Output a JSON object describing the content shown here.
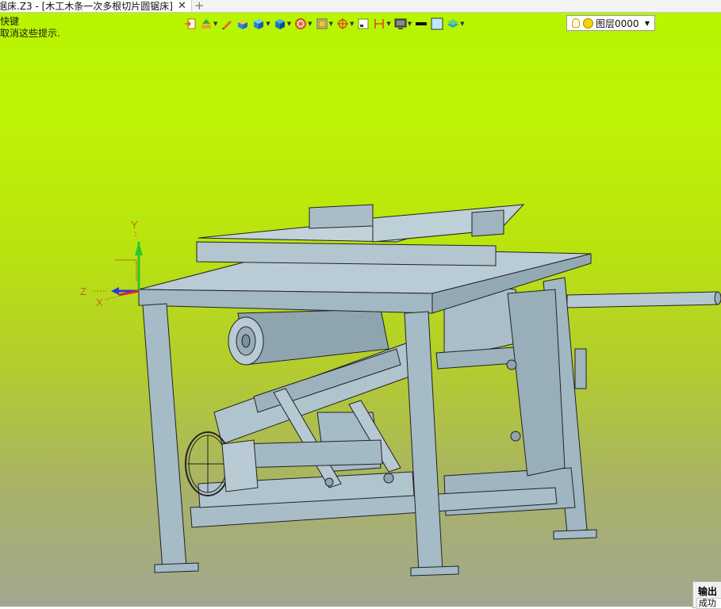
{
  "tab": {
    "title": "据床.Z3 - [木工木条一次多根切片圆锯床]",
    "close": "✕",
    "new_tab": "+"
  },
  "hint": {
    "line1": "快键",
    "line2": "取消这些提示."
  },
  "toolbar": {
    "items": [
      "import-icon",
      "render-mode-icon",
      "pencil-icon",
      "box-solid-icon",
      "cube-view-icon",
      "shaded-cube-icon",
      "display-filter-icon",
      "frame-icon",
      "target-icon",
      "small-square-icon",
      "dimension-icon",
      "monitor-icon",
      "line-style-icon",
      "color-box-icon",
      "layer-stack-icon"
    ]
  },
  "layer": {
    "name": "图层0000"
  },
  "axes": {
    "y_label": "Y",
    "z_label": "Z",
    "x_label": "X"
  },
  "output": {
    "title": "输出",
    "status": "成功"
  },
  "colors": {
    "viewport_top": "#b7f500",
    "viewport_bottom": "#a2a78f",
    "model_fill": "#9fb5c0",
    "model_edge": "#222222"
  }
}
